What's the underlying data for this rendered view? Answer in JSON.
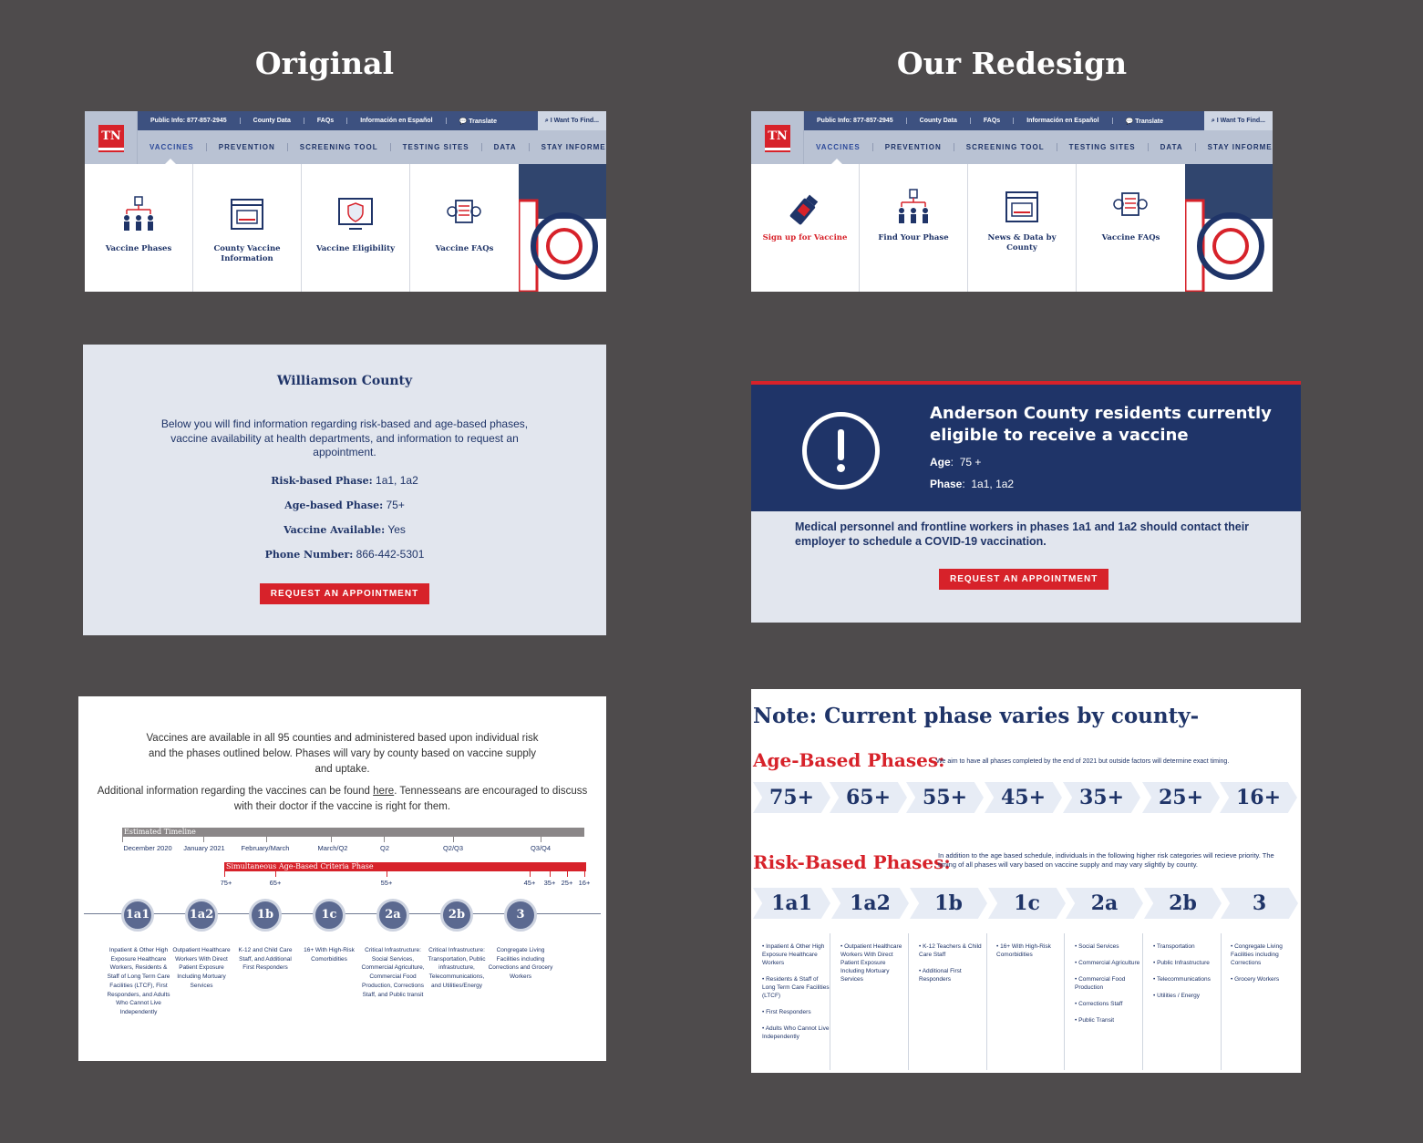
{
  "headings": {
    "left": "Original",
    "right": "Our Redesign"
  },
  "nav": {
    "logo": "TN",
    "utility": [
      "Public Info: 877-857-2945",
      "County Data",
      "FAQs",
      "Información en Español",
      "Translate"
    ],
    "find": "I Want To Find...",
    "menu": [
      "VACCINES",
      "PREVENTION",
      "SCREENING TOOL",
      "TESTING SITES",
      "DATA",
      "STAY INFORMED"
    ]
  },
  "original_dropdown": [
    "Vaccine Phases",
    "County Vaccine Information",
    "Vaccine Eligibility",
    "Vaccine FAQs"
  ],
  "redesign_dropdown": [
    "Sign up for Vaccine",
    "Find Your Phase",
    "News & Data by County",
    "Vaccine FAQs"
  ],
  "williamson": {
    "title": "Williamson County",
    "intro": "Below you will find information regarding risk-based and age-based phases, vaccine availability at health departments, and information to request an appointment.",
    "rows": [
      {
        "label": "Risk-based Phase:",
        "value": "1a1, 1a2"
      },
      {
        "label": "Age-based Phase:",
        "value": "75+"
      },
      {
        "label": "Vaccine Available:",
        "value": "Yes"
      },
      {
        "label": "Phone Number:",
        "value": "866-442-5301"
      }
    ],
    "button": "REQUEST AN APPOINTMENT"
  },
  "anderson": {
    "title": "Anderson County residents currently eligible to receive a vaccine",
    "age_label": "Age",
    "age_value": "75 +",
    "phase_label": "Phase",
    "phase_value": "1a1, 1a2",
    "note": "Medical personnel and frontline workers in phases 1a1 and 1a2  should contact their employer to schedule a  COVID-19 vaccination.",
    "button": "REQUEST AN APPOINTMENT"
  },
  "timeline": {
    "p1": "Vaccines are available in all 95 counties and administered based upon individual risk and the phases outlined below. Phases will vary by county based on vaccine supply and uptake.",
    "p2_before": "Additional information regarding the vaccines can be found ",
    "p2_link": "here",
    "p2_after": ". Tennesseans are encouraged to discuss with their doctor if the vaccine is right for them.",
    "estimated": "Estimated Timeline",
    "simultaneous": "Simultaneous Age-Based Criteria Phase",
    "dates": [
      "December 2020",
      "January 2021",
      "February/March",
      "March/Q2",
      "Q2",
      "Q2/Q3",
      "Q3/Q4"
    ],
    "ages": [
      "75+",
      "65+",
      "55+",
      "45+",
      "35+",
      "25+",
      "16+"
    ],
    "phases": [
      {
        "id": "1a1",
        "desc": "Inpatient & Other High Exposure Healthcare Workers, Residents & Staff of Long Term Care Facilities (LTCF), First Responders, and Adults Who Cannot Live Independently"
      },
      {
        "id": "1a2",
        "desc": "Outpatient Healthcare Workers With Direct Patient Exposure Including Mortuary Services"
      },
      {
        "id": "1b",
        "desc": "K-12 and Child Care Staff, and Additional First Responders"
      },
      {
        "id": "1c",
        "desc": "16+ With High-Risk Comorbidities"
      },
      {
        "id": "2a",
        "desc": "Critical Infrastructure: Social Services, Commercial Agriculture, Commercial Food Production, Corrections Staff, and Public transit"
      },
      {
        "id": "2b",
        "desc": "Critical Infrastructure: Transportation, Public infrastructure, Telecommunications, and Utilities/Energy"
      },
      {
        "id": "3",
        "desc": "Congregate Living Facilities including Corrections and Grocery Workers"
      }
    ]
  },
  "phases_redesign": {
    "note": "Note: Current phase varies by county-",
    "age_title": "Age-Based Phases:",
    "age_note": "We aim to have all phases completed by the end of 2021 but outside factors will determine exact timing.",
    "ages": [
      "75+",
      "65+",
      "55+",
      "45+",
      "35+",
      "25+",
      "16+"
    ],
    "risk_title": "Risk-Based Phases:",
    "risk_note": "In addition to the age based schedule, individuals in the following higher risk categories will recieve priority. The timing of all phases will vary based on vaccine supply and may vary slightly by county.",
    "risk": [
      {
        "id": "1a1",
        "items": [
          "• Inpatient & Other High Exposure Healthcare Workers",
          "• Residents & Staff of Long Term Care Facilities (LTCF)",
          "• First Responders",
          "• Adults Who Cannot Live Independently"
        ]
      },
      {
        "id": "1a2",
        "items": [
          "• Outpatient Healthcare Workers With Direct Patient Exposure Including Mortuary Services"
        ]
      },
      {
        "id": "1b",
        "items": [
          "• K-12 Teachers & Child Care Staff",
          "• Additional First Responders"
        ]
      },
      {
        "id": "1c",
        "items": [
          "• 16+ With High-Risk Comorbidities"
        ]
      },
      {
        "id": "2a",
        "items": [
          "• Social Services",
          "• Commercial Agriculture",
          "• Commercial Food Production",
          "• Corrections Staff",
          "• Public Transit"
        ]
      },
      {
        "id": "2b",
        "items": [
          "• Transportation",
          "• Public Infrastructure",
          "• Telecommunications",
          "• Utilities / Energy"
        ]
      },
      {
        "id": "3",
        "items": [
          "• Congregate Living Facilities including Corrections",
          "• Grocery Workers"
        ]
      }
    ]
  }
}
